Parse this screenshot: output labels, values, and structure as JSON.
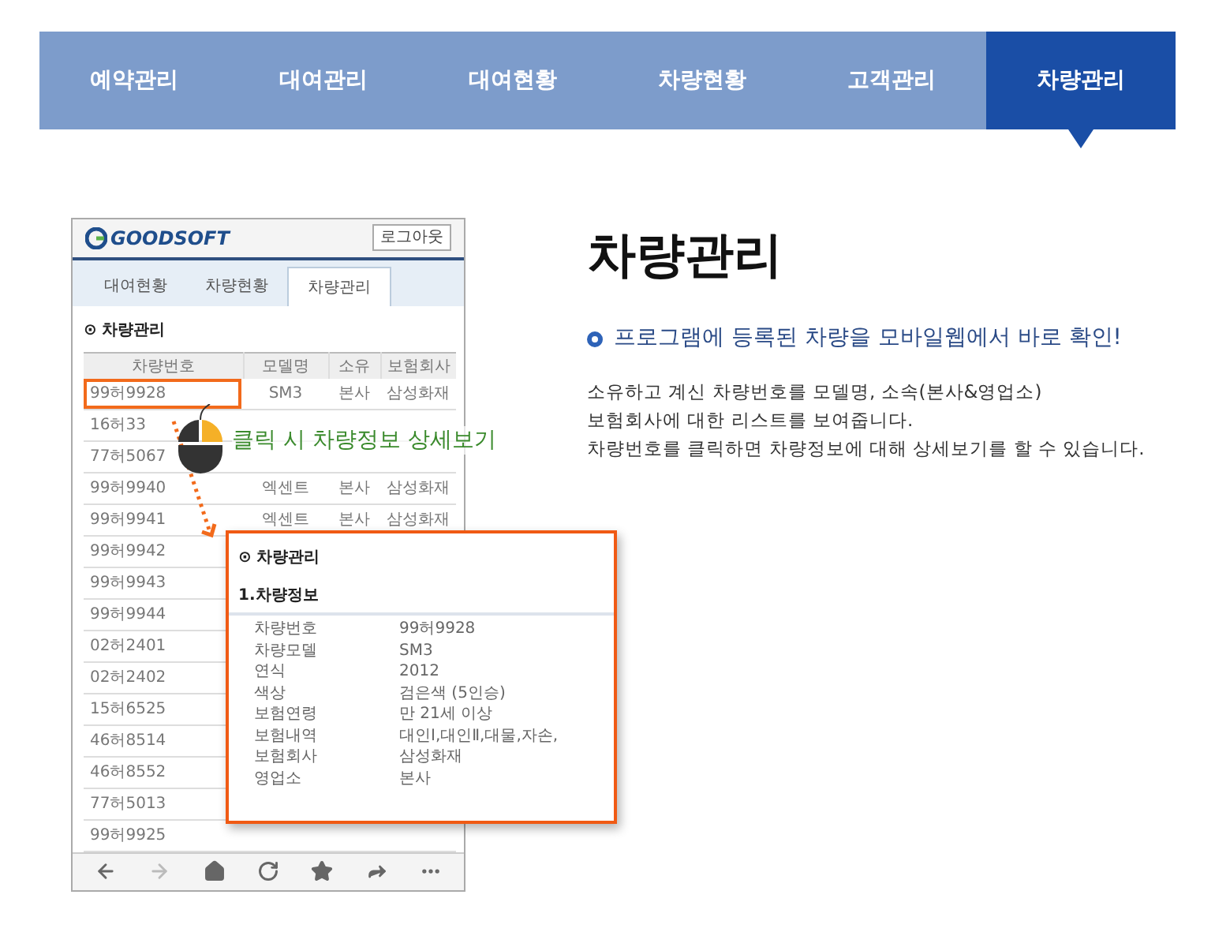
{
  "nav": [
    {
      "label": "예약관리",
      "selected": false
    },
    {
      "label": "대여관리",
      "selected": false
    },
    {
      "label": "대여현황",
      "selected": false
    },
    {
      "label": "차량현황",
      "selected": false
    },
    {
      "label": "고객관리",
      "selected": false
    },
    {
      "label": "차량관리",
      "selected": true
    }
  ],
  "phone": {
    "logo": "GOODSOFT",
    "logout": "로그아웃",
    "tabs": [
      {
        "label": "대여현황",
        "selected": false
      },
      {
        "label": "차량현황",
        "selected": false
      },
      {
        "label": "차량관리",
        "selected": true
      }
    ],
    "section_icon": "⊙",
    "section_title": "차량관리",
    "table": {
      "columns": [
        "차량번호",
        "모델명",
        "소유",
        "보험회사"
      ],
      "rows": [
        {
          "number": "99허9928",
          "model": "SM3",
          "owner": "본사",
          "insurer": "삼성화재",
          "highlighted": true
        },
        {
          "number": "16허33",
          "highlighted": false
        },
        {
          "number": "77허5067",
          "highlighted": false
        },
        {
          "number": "99허9940",
          "model": "엑센트",
          "owner": "본사",
          "insurer": "삼성화재",
          "highlighted": false
        },
        {
          "number": "99허9941",
          "model": "엑센트",
          "owner": "본사",
          "insurer": "삼성화재",
          "highlighted": false
        },
        {
          "number": "99허9942",
          "highlighted": false
        },
        {
          "number": "99허9943",
          "highlighted": false
        },
        {
          "number": "99허9944",
          "highlighted": false
        },
        {
          "number": "02허2401",
          "highlighted": false
        },
        {
          "number": "02허2402",
          "highlighted": false
        },
        {
          "number": "15허6525",
          "highlighted": false
        },
        {
          "number": "46허8514",
          "highlighted": false
        },
        {
          "number": "46허8552",
          "highlighted": false
        },
        {
          "number": "77허5013",
          "highlighted": false
        },
        {
          "number": "99허9925",
          "highlighted": false
        }
      ]
    },
    "toolbar": [
      {
        "kind": "back",
        "disabled": false
      },
      {
        "kind": "forward",
        "disabled": true
      },
      {
        "kind": "home",
        "disabled": false
      },
      {
        "kind": "refresh",
        "disabled": false
      },
      {
        "kind": "star",
        "disabled": false
      },
      {
        "kind": "share",
        "disabled": false
      },
      {
        "kind": "more",
        "disabled": false
      }
    ]
  },
  "callout": "클릭 시 차량정보 상세보기",
  "popup": {
    "icon": "⊙",
    "title": "차량관리",
    "subtitle": "1.차량정보",
    "fields": [
      {
        "label": "차량번호",
        "value": "99허9928"
      },
      {
        "label": "차량모델",
        "value": "SM3"
      },
      {
        "label": "연식",
        "value": "2012"
      },
      {
        "label": "색상",
        "value": "검은색 (5인승)"
      },
      {
        "label": "보험연령",
        "value": "만 21세 이상"
      },
      {
        "label": "보험내역",
        "value": "대인Ⅰ,대인Ⅱ,대물,자손,"
      },
      {
        "label": "보험회사",
        "value": "삼성화재"
      },
      {
        "label": "영업소",
        "value": "본사"
      }
    ]
  },
  "info": {
    "title": "차량관리",
    "headline": "프로그램에 등록된 차량을 모바일웹에서 바로 확인!",
    "description": [
      "소유하고 계신 차량번호를 모델명, 소속(본사&영업소)",
      "보험회사에 대한 리스트를 보여줍니다.",
      "차량번호를 클릭하면 차량정보에 대해 상세보기를 할 수 있습니다."
    ]
  }
}
